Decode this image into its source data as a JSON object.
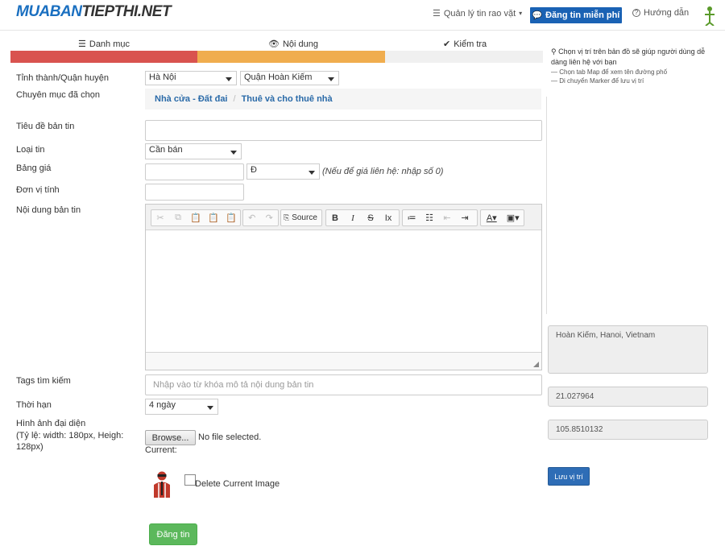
{
  "header": {
    "logo_part1": "MUABAN",
    "logo_part2": "TIEPTHI.NET",
    "manage_label": "Quản lý tin rao vặt",
    "post_button": "Đăng tin miễn phí",
    "help_label": "Hướng dẫn"
  },
  "steps": [
    {
      "label": "Danh mục",
      "color": "#d9534f"
    },
    {
      "label": "Nội dung",
      "color": "#f0ad4e"
    },
    {
      "label": "Kiểm tra",
      "color": "#f0f0f0"
    }
  ],
  "form": {
    "location_label": "Tỉnh thành/Quận huyện",
    "province_value": "Hà Nội",
    "district_value": "Quận Hoàn Kiếm",
    "category_label": "Chuyên mục đã chọn",
    "category_crumb": [
      "Nhà cửa - Đất đai",
      "Thuê và cho thuê nhà"
    ],
    "title_label": "Tiêu đề bản tin",
    "title_value": "",
    "type_label": "Loại tin",
    "type_value": "Cần bán",
    "price_label": "Bảng giá",
    "price_value": "",
    "currency_value": "Đ",
    "price_hint": "(Nếu để giá liên hệ: nhập số 0)",
    "unit_label": "Đơn vị tính",
    "unit_value": "",
    "content_label": "Nội dung bản tin",
    "source_label": "Source",
    "tags_label": "Tags tìm kiếm",
    "tags_placeholder": "Nhập vào từ khóa mô tả nội dung bản tin",
    "duration_label": "Thời hạn",
    "duration_value": "4 ngày",
    "image_label": "Hình ảnh đại diện",
    "image_hint": "(Tỷ lệ: width: 180px, Heigh: 128px)",
    "browse_label": "Browse...",
    "file_status": "No file selected.",
    "current_label": "Current:",
    "delete_image_label": "Delete Current Image",
    "submit_label": "Đăng tin"
  },
  "sidebar": {
    "note": "Chọn vị trí trên bản đồ sẽ giúp người dùng dễ dàng liên hệ với bạn",
    "tip1": "— Chọn tab Map để xem tên đường phố",
    "tip2": "— Di chuyển Marker để lưu vị trí",
    "address": "Hoàn Kiếm, Hanoi, Vietnam",
    "latitude": "21.027964",
    "longitude": "105.8510132",
    "save_location": "Lưu vị trí"
  },
  "icons": {
    "list": "list-icon",
    "eye": "eye-icon",
    "check": "check-icon",
    "comment": "comment-icon",
    "help": "help-icon",
    "map_marker": "map-marker-icon"
  }
}
